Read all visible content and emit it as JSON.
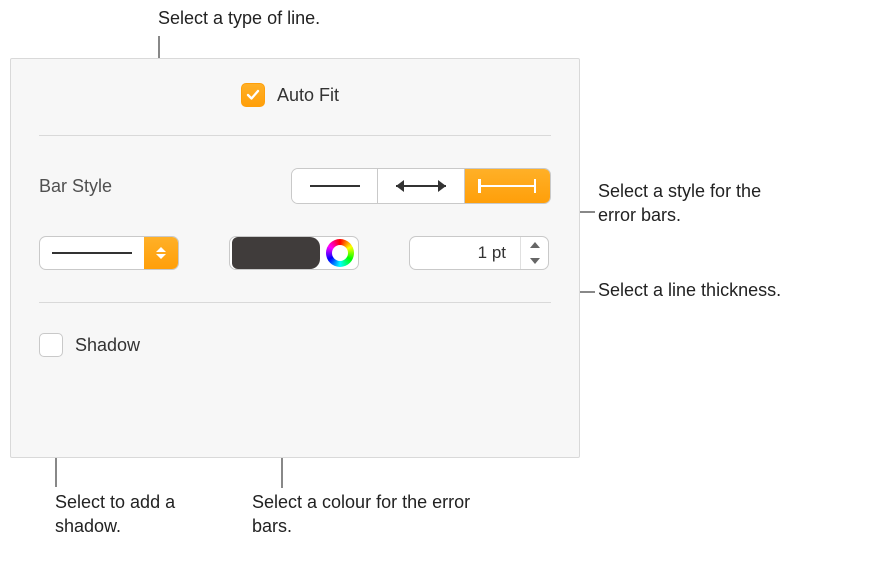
{
  "callouts": {
    "lineType": "Select a type of line.",
    "barStyle": "Select a style for the error bars.",
    "thickness": "Select a line thickness.",
    "shadow": "Select to add a shadow.",
    "colour": "Select a colour for the error bars."
  },
  "panel": {
    "autoFitLabel": "Auto Fit",
    "autoFitChecked": true,
    "barStyleLabel": "Bar Style",
    "thicknessValue": "1 pt",
    "shadowLabel": "Shadow",
    "shadowChecked": false,
    "colorSwatch": "#403c3b"
  }
}
